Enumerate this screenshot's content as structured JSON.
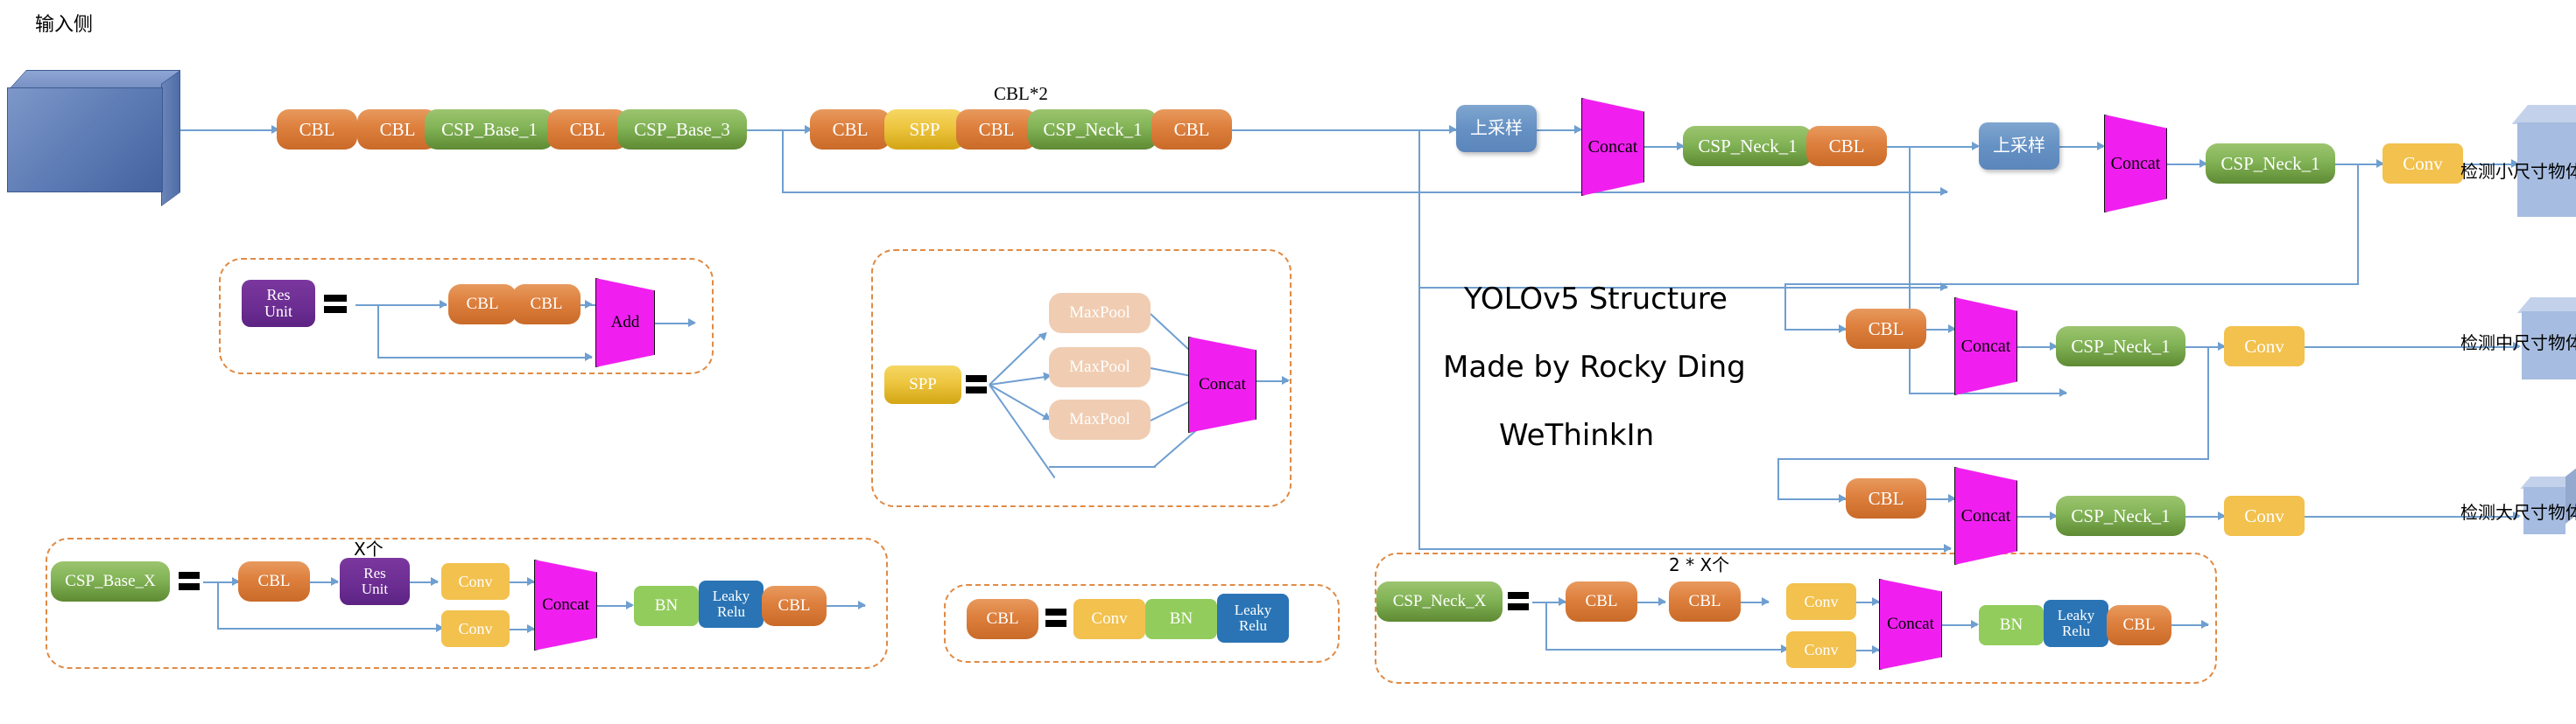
{
  "title_block": {
    "line1": "YOLOv5 Structure",
    "line2": "Made by Rocky Ding",
    "line3": "WeThinkIn"
  },
  "input": {
    "label": "输入侧"
  },
  "backbone": {
    "nodes": [
      {
        "label": "CBL",
        "type": "cbl"
      },
      {
        "label": "CBL",
        "type": "cbl"
      },
      {
        "label": "CSP_Base_1",
        "type": "csp"
      },
      {
        "label": "CBL",
        "type": "cbl"
      },
      {
        "label": "CSP_Base_3",
        "type": "csp"
      }
    ]
  },
  "neck_top": {
    "annotation": "CBL*2",
    "nodes": [
      {
        "label": "CBL",
        "type": "cbl"
      },
      {
        "label": "SPP",
        "type": "spp"
      },
      {
        "label": "CBL",
        "type": "cbl"
      },
      {
        "label": "CSP_Neck_1",
        "type": "csp"
      },
      {
        "label": "CBL",
        "type": "cbl"
      }
    ],
    "upsample_1": "上采样",
    "concat_1": "Concat",
    "after_concat_1": [
      {
        "label": "CSP_Neck_1",
        "type": "csp"
      },
      {
        "label": "CBL",
        "type": "cbl"
      }
    ],
    "upsample_2": "上采样",
    "concat_2": "Concat",
    "after_concat_2": [
      {
        "label": "CSP_Neck_1",
        "type": "csp"
      }
    ],
    "conv_out_1": "Conv"
  },
  "branch_mid": {
    "cbl": "CBL",
    "concat": "Concat",
    "csp": "CSP_Neck_1",
    "conv": "Conv"
  },
  "branch_low": {
    "cbl": "CBL",
    "concat": "Concat",
    "csp": "CSP_Neck_1",
    "conv": "Conv"
  },
  "outputs": [
    {
      "label": "检测小尺寸物体",
      "size": "large"
    },
    {
      "label": "检测中尺寸物体",
      "size": "medium"
    },
    {
      "label": "检测大尺寸物体",
      "size": "small"
    }
  ],
  "legend_res_unit": {
    "lhs": "Res\nUnit",
    "lhs_line1": "Res",
    "lhs_line2": "Unit",
    "equals": "=",
    "nodes": [
      {
        "label": "CBL",
        "type": "cbl"
      },
      {
        "label": "CBL",
        "type": "cbl"
      }
    ],
    "merge": "Add"
  },
  "legend_spp": {
    "lhs": "SPP",
    "equals": "=",
    "branches": [
      "MaxPool",
      "MaxPool",
      "MaxPool"
    ],
    "merge": "Concat"
  },
  "legend_csp_base": {
    "lhs": "CSP_Base_X",
    "equals": "=",
    "repeat_label": "X个",
    "top_chain": [
      {
        "label": "CBL",
        "type": "cbl"
      },
      {
        "label": "Res\nUnit",
        "type": "res",
        "line1": "Res",
        "line2": "Unit"
      },
      {
        "label": "Conv",
        "type": "conv"
      }
    ],
    "bottom_chain": [
      {
        "label": "Conv",
        "type": "conv"
      }
    ],
    "merge": "Concat",
    "tail": [
      {
        "label": "BN",
        "type": "bn"
      },
      {
        "label": "Leaky\nRelu",
        "type": "leaky",
        "line1": "Leaky",
        "line2": "Relu"
      },
      {
        "label": "CBL",
        "type": "cbl"
      }
    ]
  },
  "legend_cbl": {
    "lhs": "CBL",
    "equals": "=",
    "nodes": [
      {
        "label": "Conv",
        "type": "conv"
      },
      {
        "label": "BN",
        "type": "bn"
      },
      {
        "label": "Leaky\nRelu",
        "type": "leaky",
        "line1": "Leaky",
        "line2": "Relu"
      }
    ]
  },
  "legend_csp_neck": {
    "lhs": "CSP_Neck_X",
    "equals": "=",
    "repeat_label": "2 * X个",
    "top_chain": [
      {
        "label": "CBL",
        "type": "cbl"
      },
      {
        "label": "CBL",
        "type": "cbl"
      },
      {
        "label": "Conv",
        "type": "conv"
      }
    ],
    "bottom_chain": [
      {
        "label": "Conv",
        "type": "conv"
      }
    ],
    "merge": "Concat",
    "tail": [
      {
        "label": "BN",
        "type": "bn"
      },
      {
        "label": "Leaky\nRelu",
        "type": "leaky",
        "line1": "Leaky",
        "line2": "Relu"
      },
      {
        "label": "CBL",
        "type": "cbl"
      }
    ]
  },
  "colors": {
    "cbl": "#dd7f3d",
    "csp": "#82b356",
    "spp": "#edc53f",
    "conv": "#f2c14e",
    "bn": "#92cc5c",
    "leaky": "#2a74b5",
    "res": "#6b2d92",
    "concat": "#f01ff0",
    "upsample": "#6691c4",
    "maxpool": "#f0cdb2",
    "connector": "#6f9fd0",
    "legend_frame": "#e08a44",
    "cube": "#a6bce0"
  }
}
